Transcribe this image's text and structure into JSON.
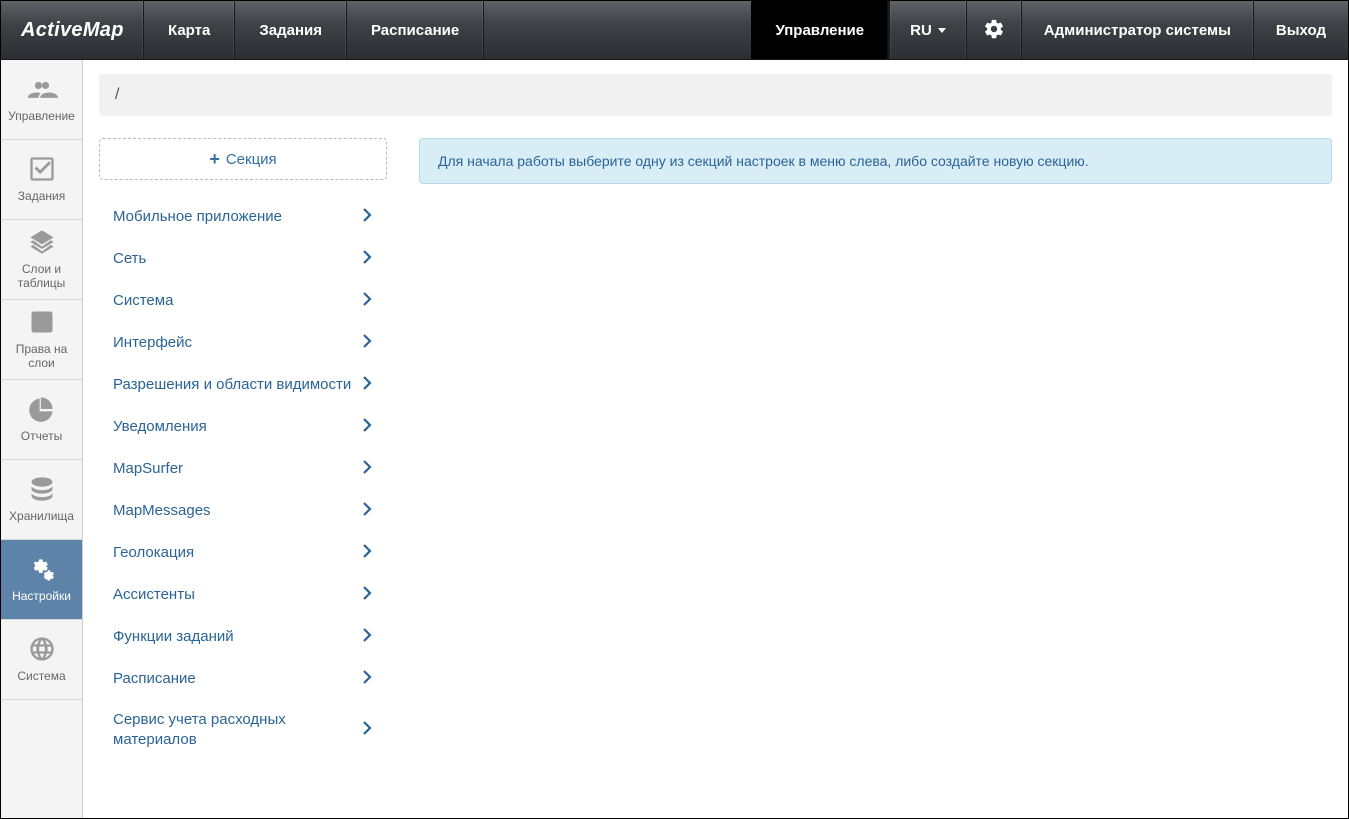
{
  "app_name": "ActiveMap",
  "top_nav": {
    "items": [
      {
        "label": "Карта"
      },
      {
        "label": "Задания"
      },
      {
        "label": "Расписание"
      }
    ],
    "active_label": "Управление"
  },
  "header": {
    "language": "RU",
    "user": "Администратор системы",
    "logout": "Выход"
  },
  "sidebar": {
    "items": [
      {
        "label": "Управление"
      },
      {
        "label": "Задания"
      },
      {
        "label": "Слои и таблицы"
      },
      {
        "label": "Права на слои"
      },
      {
        "label": "Отчеты"
      },
      {
        "label": "Хранилища"
      },
      {
        "label": "Настройки"
      },
      {
        "label": "Система"
      }
    ]
  },
  "breadcrumb": "/",
  "add_section_label": "Секция",
  "sections": [
    {
      "label": "Мобильное приложение"
    },
    {
      "label": "Сеть"
    },
    {
      "label": "Система"
    },
    {
      "label": "Интерфейс"
    },
    {
      "label": "Разрешения и области видимости"
    },
    {
      "label": "Уведомления"
    },
    {
      "label": "MapSurfer"
    },
    {
      "label": "MapMessages"
    },
    {
      "label": "Геолокация"
    },
    {
      "label": "Ассистенты"
    },
    {
      "label": "Функции заданий"
    },
    {
      "label": "Расписание"
    },
    {
      "label": "Сервис учета расходных материалов"
    }
  ],
  "info_message": "Для начала работы выберите одну из секций настроек в меню слева, либо создайте новую секцию."
}
